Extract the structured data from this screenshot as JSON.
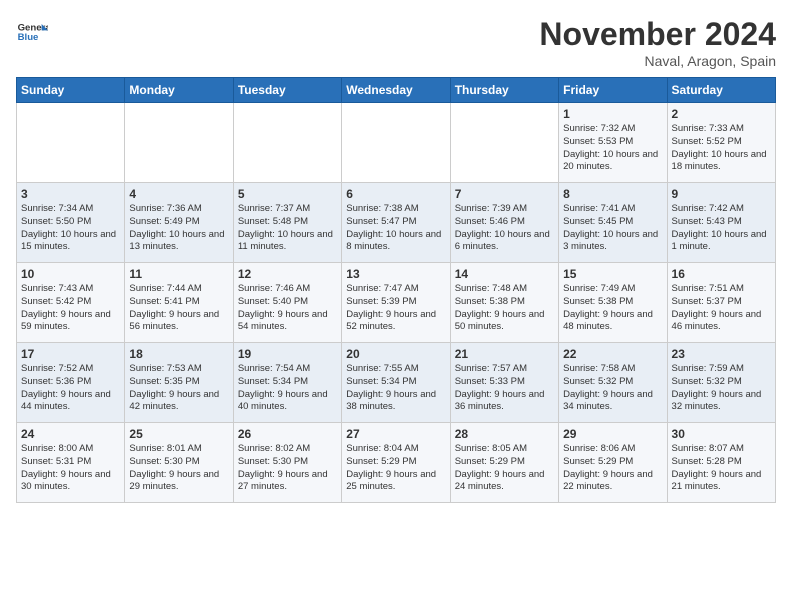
{
  "logo": {
    "general": "General",
    "blue": "Blue"
  },
  "header": {
    "month_year": "November 2024",
    "location": "Naval, Aragon, Spain"
  },
  "days_of_week": [
    "Sunday",
    "Monday",
    "Tuesday",
    "Wednesday",
    "Thursday",
    "Friday",
    "Saturday"
  ],
  "weeks": [
    [
      {
        "day": "",
        "info": ""
      },
      {
        "day": "",
        "info": ""
      },
      {
        "day": "",
        "info": ""
      },
      {
        "day": "",
        "info": ""
      },
      {
        "day": "",
        "info": ""
      },
      {
        "day": "1",
        "info": "Sunrise: 7:32 AM\nSunset: 5:53 PM\nDaylight: 10 hours\nand 20 minutes."
      },
      {
        "day": "2",
        "info": "Sunrise: 7:33 AM\nSunset: 5:52 PM\nDaylight: 10 hours\nand 18 minutes."
      }
    ],
    [
      {
        "day": "3",
        "info": "Sunrise: 7:34 AM\nSunset: 5:50 PM\nDaylight: 10 hours\nand 15 minutes."
      },
      {
        "day": "4",
        "info": "Sunrise: 7:36 AM\nSunset: 5:49 PM\nDaylight: 10 hours\nand 13 minutes."
      },
      {
        "day": "5",
        "info": "Sunrise: 7:37 AM\nSunset: 5:48 PM\nDaylight: 10 hours\nand 11 minutes."
      },
      {
        "day": "6",
        "info": "Sunrise: 7:38 AM\nSunset: 5:47 PM\nDaylight: 10 hours\nand 8 minutes."
      },
      {
        "day": "7",
        "info": "Sunrise: 7:39 AM\nSunset: 5:46 PM\nDaylight: 10 hours\nand 6 minutes."
      },
      {
        "day": "8",
        "info": "Sunrise: 7:41 AM\nSunset: 5:45 PM\nDaylight: 10 hours\nand 3 minutes."
      },
      {
        "day": "9",
        "info": "Sunrise: 7:42 AM\nSunset: 5:43 PM\nDaylight: 10 hours\nand 1 minute."
      }
    ],
    [
      {
        "day": "10",
        "info": "Sunrise: 7:43 AM\nSunset: 5:42 PM\nDaylight: 9 hours\nand 59 minutes."
      },
      {
        "day": "11",
        "info": "Sunrise: 7:44 AM\nSunset: 5:41 PM\nDaylight: 9 hours\nand 56 minutes."
      },
      {
        "day": "12",
        "info": "Sunrise: 7:46 AM\nSunset: 5:40 PM\nDaylight: 9 hours\nand 54 minutes."
      },
      {
        "day": "13",
        "info": "Sunrise: 7:47 AM\nSunset: 5:39 PM\nDaylight: 9 hours\nand 52 minutes."
      },
      {
        "day": "14",
        "info": "Sunrise: 7:48 AM\nSunset: 5:38 PM\nDaylight: 9 hours\nand 50 minutes."
      },
      {
        "day": "15",
        "info": "Sunrise: 7:49 AM\nSunset: 5:38 PM\nDaylight: 9 hours\nand 48 minutes."
      },
      {
        "day": "16",
        "info": "Sunrise: 7:51 AM\nSunset: 5:37 PM\nDaylight: 9 hours\nand 46 minutes."
      }
    ],
    [
      {
        "day": "17",
        "info": "Sunrise: 7:52 AM\nSunset: 5:36 PM\nDaylight: 9 hours\nand 44 minutes."
      },
      {
        "day": "18",
        "info": "Sunrise: 7:53 AM\nSunset: 5:35 PM\nDaylight: 9 hours\nand 42 minutes."
      },
      {
        "day": "19",
        "info": "Sunrise: 7:54 AM\nSunset: 5:34 PM\nDaylight: 9 hours\nand 40 minutes."
      },
      {
        "day": "20",
        "info": "Sunrise: 7:55 AM\nSunset: 5:34 PM\nDaylight: 9 hours\nand 38 minutes."
      },
      {
        "day": "21",
        "info": "Sunrise: 7:57 AM\nSunset: 5:33 PM\nDaylight: 9 hours\nand 36 minutes."
      },
      {
        "day": "22",
        "info": "Sunrise: 7:58 AM\nSunset: 5:32 PM\nDaylight: 9 hours\nand 34 minutes."
      },
      {
        "day": "23",
        "info": "Sunrise: 7:59 AM\nSunset: 5:32 PM\nDaylight: 9 hours\nand 32 minutes."
      }
    ],
    [
      {
        "day": "24",
        "info": "Sunrise: 8:00 AM\nSunset: 5:31 PM\nDaylight: 9 hours\nand 30 minutes."
      },
      {
        "day": "25",
        "info": "Sunrise: 8:01 AM\nSunset: 5:30 PM\nDaylight: 9 hours\nand 29 minutes."
      },
      {
        "day": "26",
        "info": "Sunrise: 8:02 AM\nSunset: 5:30 PM\nDaylight: 9 hours\nand 27 minutes."
      },
      {
        "day": "27",
        "info": "Sunrise: 8:04 AM\nSunset: 5:29 PM\nDaylight: 9 hours\nand 25 minutes."
      },
      {
        "day": "28",
        "info": "Sunrise: 8:05 AM\nSunset: 5:29 PM\nDaylight: 9 hours\nand 24 minutes."
      },
      {
        "day": "29",
        "info": "Sunrise: 8:06 AM\nSunset: 5:29 PM\nDaylight: 9 hours\nand 22 minutes."
      },
      {
        "day": "30",
        "info": "Sunrise: 8:07 AM\nSunset: 5:28 PM\nDaylight: 9 hours\nand 21 minutes."
      }
    ]
  ]
}
